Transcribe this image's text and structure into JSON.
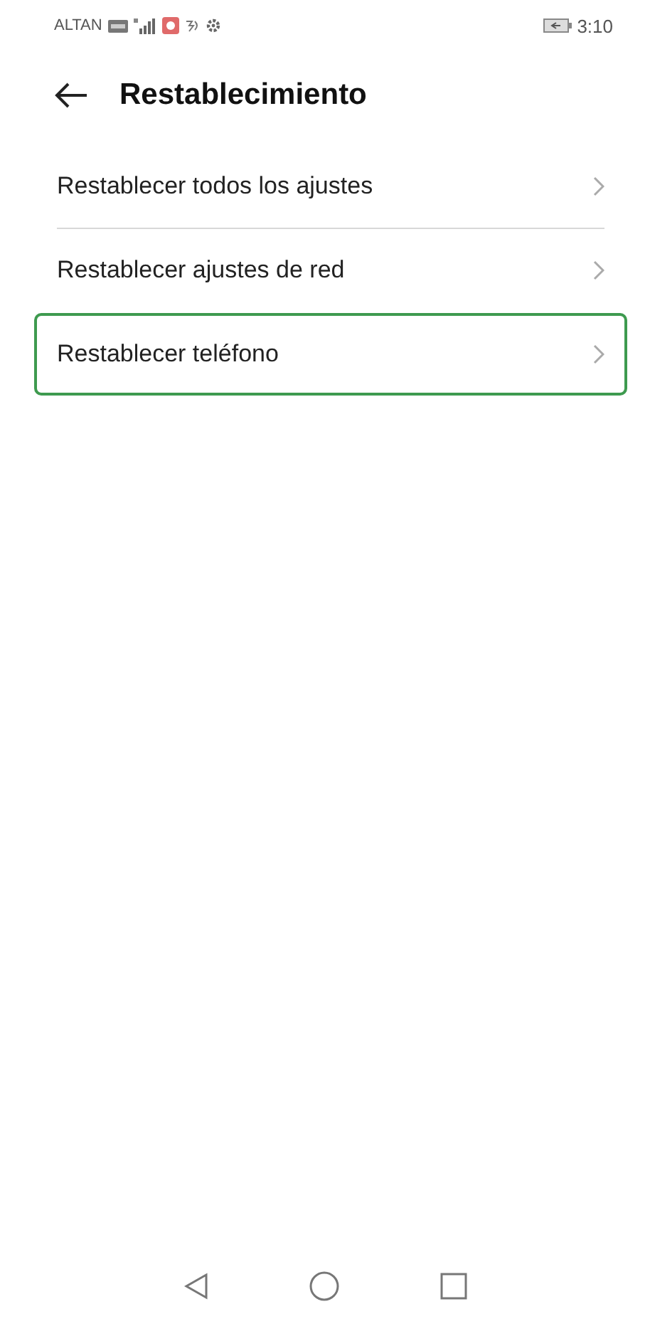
{
  "status_bar": {
    "carrier": "ALTAN",
    "time": "3:10"
  },
  "header": {
    "title": "Restablecimiento"
  },
  "items": [
    {
      "label": "Restablecer todos los ajustes",
      "selected": false
    },
    {
      "label": "Restablecer ajustes de red",
      "selected": false
    },
    {
      "label": "Restablecer teléfono",
      "selected": true
    }
  ]
}
